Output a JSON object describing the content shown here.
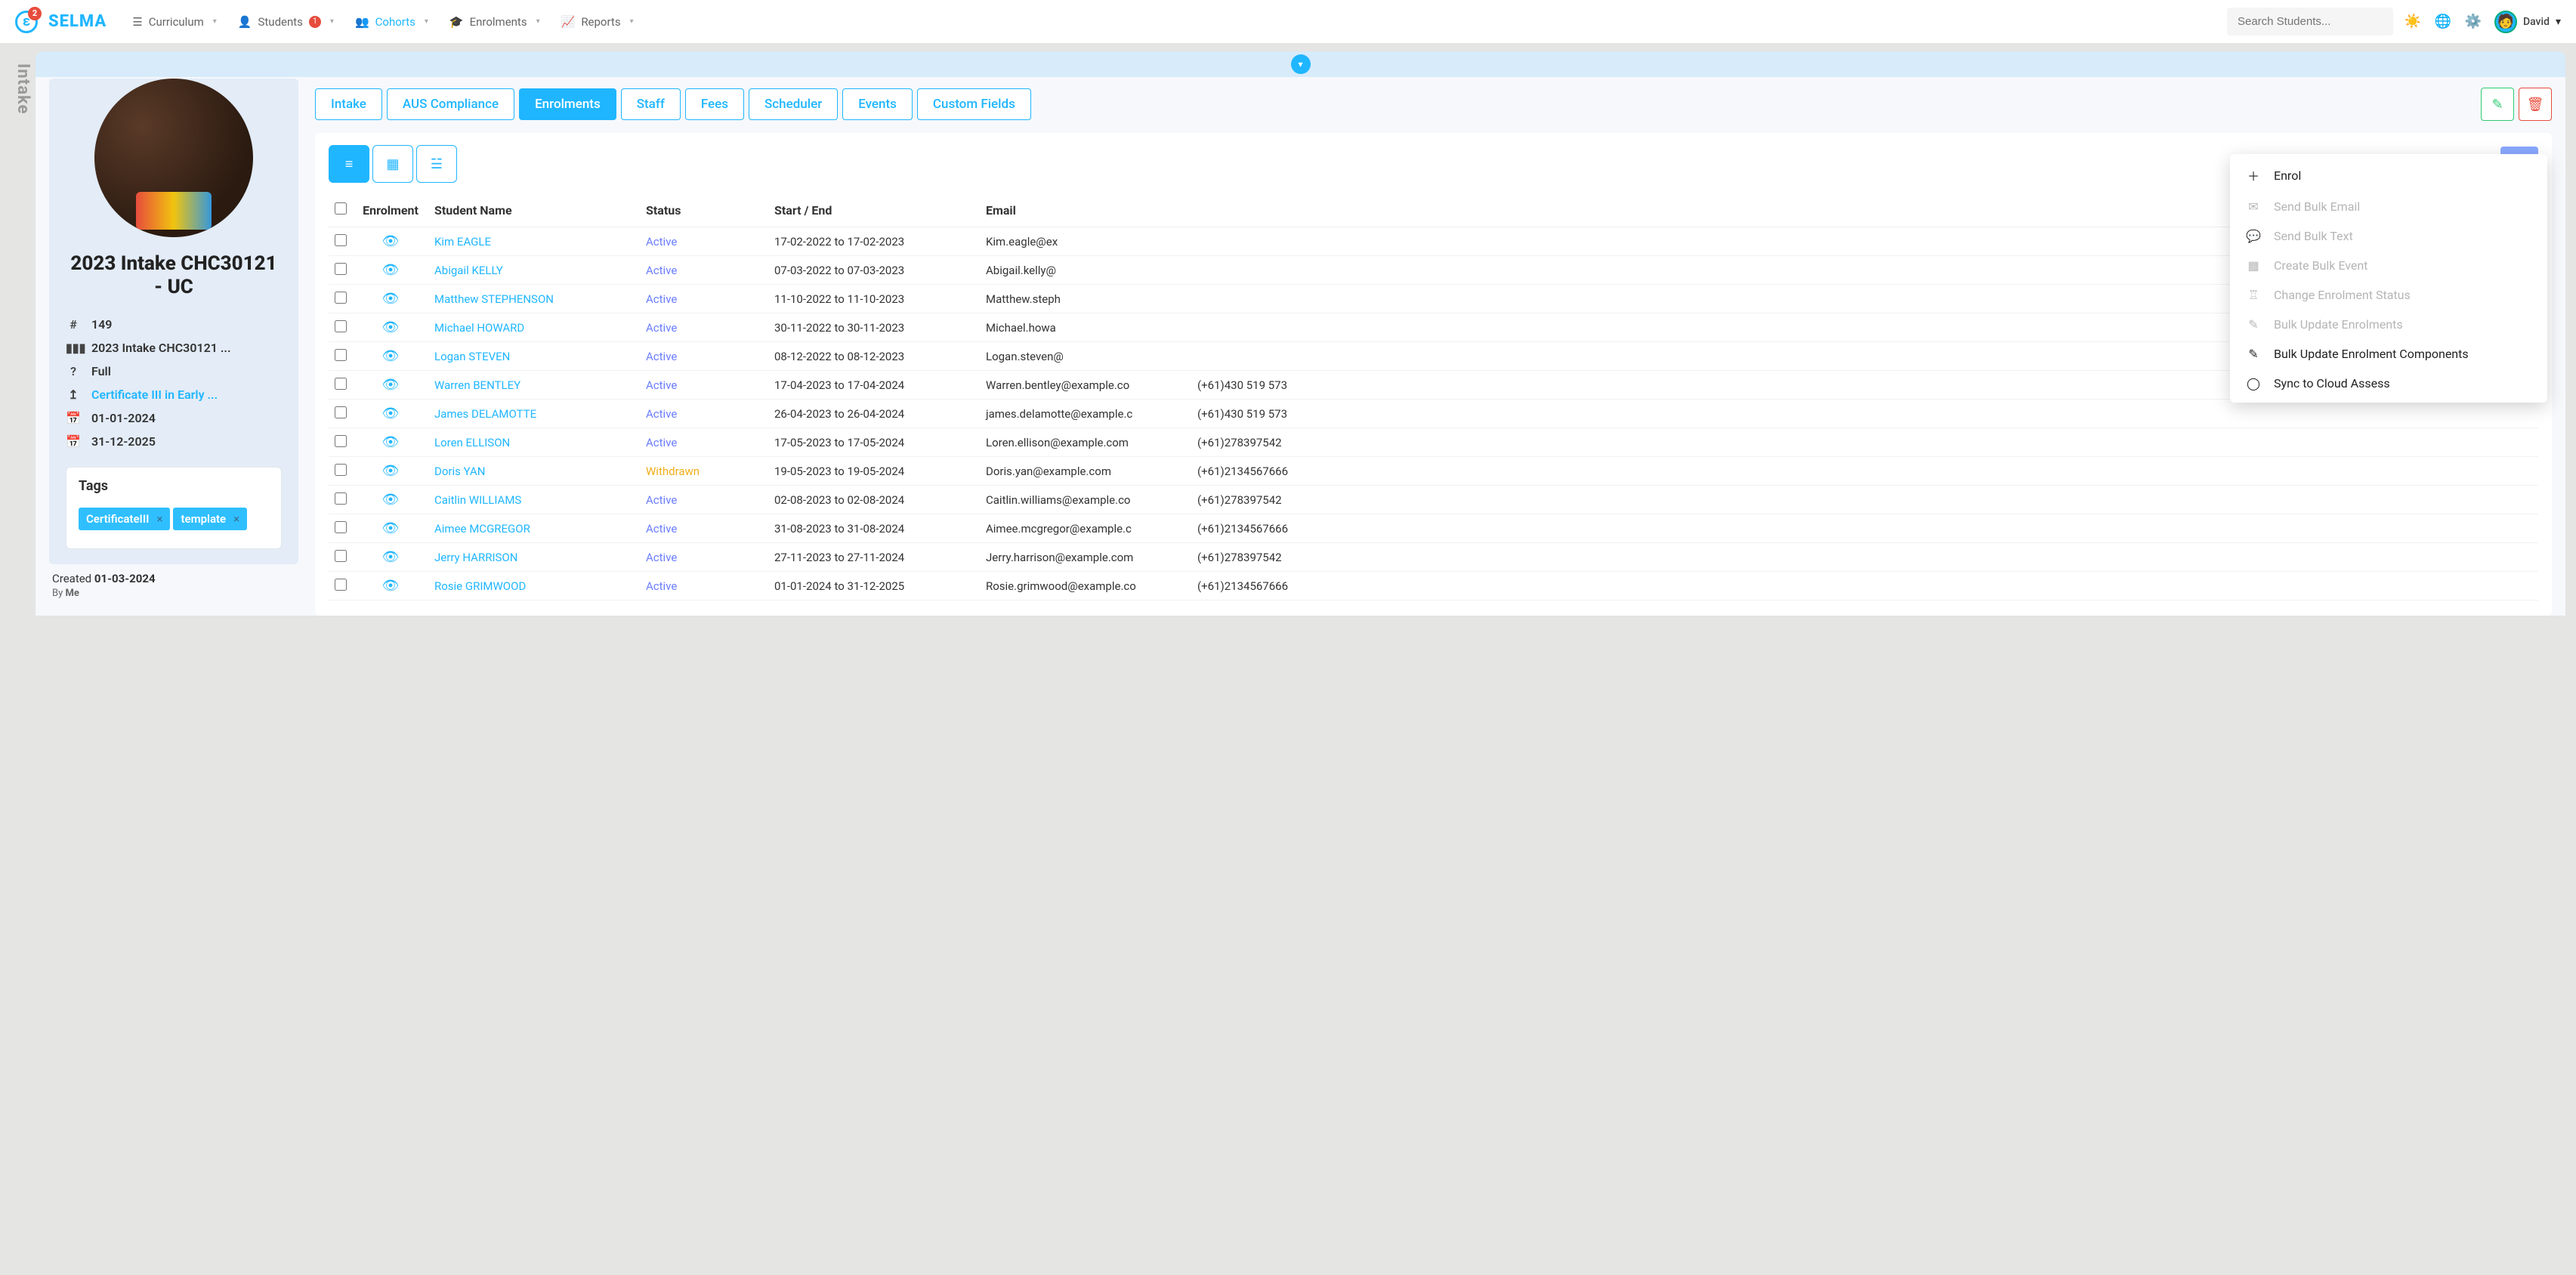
{
  "header": {
    "logo_text": "SELMA",
    "logo_badge": "2",
    "nav": [
      {
        "label": "Curriculum",
        "icon": "☰"
      },
      {
        "label": "Students",
        "icon": "👤",
        "badge": "1"
      },
      {
        "label": "Cohorts",
        "icon": "👥",
        "active": true
      },
      {
        "label": "Enrolments",
        "icon": "🎓"
      },
      {
        "label": "Reports",
        "icon": "📈"
      }
    ],
    "search_placeholder": "Search Students...",
    "user_name": "David"
  },
  "vtab_label": "Intake",
  "sidebar": {
    "title": "2023 Intake CHC30121 - UC",
    "rows": [
      {
        "icon": "#",
        "text": "149"
      },
      {
        "icon": "▮▮▮",
        "text": "2023 Intake CHC30121 ..."
      },
      {
        "icon": "?",
        "text": "Full"
      },
      {
        "icon": "↥",
        "text": "Certificate III in Early ...",
        "link": true
      },
      {
        "icon": "📅",
        "text": "01-01-2024"
      },
      {
        "icon": "📅",
        "text": "31-12-2025"
      }
    ],
    "tags_label": "Tags",
    "tags": [
      "CertificateIII",
      "template"
    ],
    "created_label": "Created",
    "created_date": "01-03-2024",
    "by_label": "By",
    "by_value": "Me"
  },
  "tabs": [
    "Intake",
    "AUS Compliance",
    "Enrolments",
    "Staff",
    "Fees",
    "Scheduler",
    "Events",
    "Custom Fields"
  ],
  "active_tab": 2,
  "table": {
    "columns": [
      "",
      "Enrolment",
      "Student Name",
      "Status",
      "Start / End",
      "Email",
      ""
    ],
    "phone_col_visible_label": "",
    "rows": [
      {
        "name": "Kim EAGLE",
        "status": "Active",
        "range": "17-02-2022 to 17-02-2023",
        "email": "Kim.eagle@ex",
        "phone": ""
      },
      {
        "name": "Abigail KELLY",
        "status": "Active",
        "range": "07-03-2022 to 07-03-2023",
        "email": "Abigail.kelly@",
        "phone": ""
      },
      {
        "name": "Matthew STEPHENSON",
        "status": "Active",
        "range": "11-10-2022 to 11-10-2023",
        "email": "Matthew.steph",
        "phone": ""
      },
      {
        "name": "Michael HOWARD",
        "status": "Active",
        "range": "30-11-2022 to 30-11-2023",
        "email": "Michael.howa",
        "phone": ""
      },
      {
        "name": "Logan STEVEN",
        "status": "Active",
        "range": "08-12-2022 to 08-12-2023",
        "email": "Logan.steven@",
        "phone": ""
      },
      {
        "name": "Warren BENTLEY",
        "status": "Active",
        "range": "17-04-2023 to 17-04-2024",
        "email": "Warren.bentley@example.co",
        "phone": "(+61)430 519 573"
      },
      {
        "name": "James DELAMOTTE",
        "status": "Active",
        "range": "26-04-2023 to 26-04-2024",
        "email": "james.delamotte@example.c",
        "phone": "(+61)430 519 573"
      },
      {
        "name": "Loren ELLISON",
        "status": "Active",
        "range": "17-05-2023 to 17-05-2024",
        "email": "Loren.ellison@example.com",
        "phone": "(+61)278397542"
      },
      {
        "name": "Doris YAN",
        "status": "Withdrawn",
        "range": "19-05-2023 to 19-05-2024",
        "email": "Doris.yan@example.com",
        "phone": "(+61)2134567666"
      },
      {
        "name": "Caitlin WILLIAMS",
        "status": "Active",
        "range": "02-08-2023 to 02-08-2024",
        "email": "Caitlin.williams@example.co",
        "phone": "(+61)278397542"
      },
      {
        "name": "Aimee MCGREGOR",
        "status": "Active",
        "range": "31-08-2023 to 31-08-2024",
        "email": "Aimee.mcgregor@example.c",
        "phone": "(+61)2134567666"
      },
      {
        "name": "Jerry HARRISON",
        "status": "Active",
        "range": "27-11-2023 to 27-11-2024",
        "email": "Jerry.harrison@example.com",
        "phone": "(+61)278397542"
      },
      {
        "name": "Rosie GRIMWOOD",
        "status": "Active",
        "range": "01-01-2024 to 31-12-2025",
        "email": "Rosie.grimwood@example.co",
        "phone": "(+61)2134567666"
      }
    ]
  },
  "dropdown": [
    {
      "icon": "＋",
      "label": "Enrol",
      "enabled": true
    },
    {
      "icon": "✉",
      "label": "Send Bulk Email",
      "enabled": false
    },
    {
      "icon": "💬",
      "label": "Send Bulk Text",
      "enabled": false
    },
    {
      "icon": "▦",
      "label": "Create Bulk Event",
      "enabled": false
    },
    {
      "icon": "♖",
      "label": "Change Enrolment Status",
      "enabled": false
    },
    {
      "icon": "✎",
      "label": "Bulk Update Enrolments",
      "enabled": false
    },
    {
      "icon": "✎",
      "label": "Bulk Update Enrolment Components",
      "enabled": true
    },
    {
      "icon": "◯",
      "label": "Sync to Cloud Assess",
      "enabled": true
    }
  ]
}
